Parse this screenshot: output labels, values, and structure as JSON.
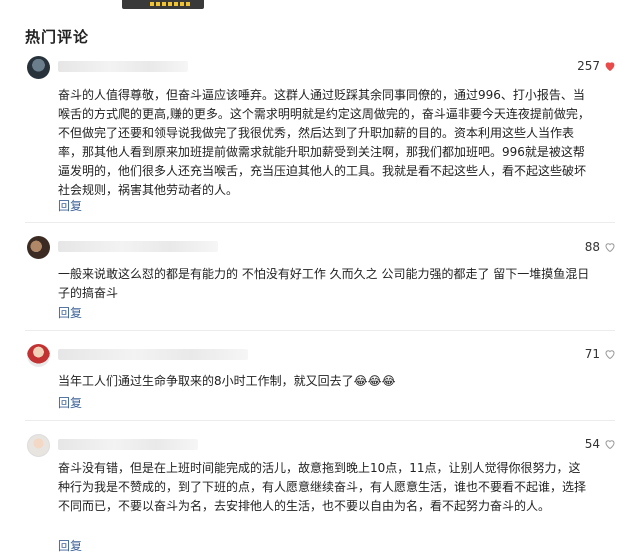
{
  "section_title": "热门评论",
  "comments": [
    {
      "likes": "257",
      "liked": true,
      "text": "奋斗的人值得尊敬，但奋斗逼应该唾弃。这群人通过贬踩其余同事同僚的，通过996、打小报告、当喉舌的方式爬的更高,赚的更多。这个需求明明就是约定这周做完的，奋斗逼非要今天连夜提前做完，不但做完了还要和领导说我做完了我很优秀，然后达到了升职加薪的目的。资本利用这些人当作表率，那其他人看到原来加班提前做需求就能升职加薪受到关注啊，那我们都加班吧。996就是被这帮逼发明的，他们很多人还充当喉舌，充当压迫其他人的工具。我就是看不起这些人，看不起这些破坏社会规则，祸害其他劳动者的人。",
      "reply": "回复"
    },
    {
      "likes": "88",
      "liked": false,
      "text": "一般来说敢这么怼的都是有能力的 不怕没有好工作 久而久之 公司能力强的都走了 留下一堆摸鱼混日子的搞奋斗",
      "reply": "回复"
    },
    {
      "likes": "71",
      "liked": false,
      "text": "当年工人们通过生命争取来的8小时工作制，就又回去了😂😂😂",
      "reply": "回复"
    },
    {
      "likes": "54",
      "liked": false,
      "text": "奋斗没有错，但是在上班时间能完成的活儿，故意拖到晚上10点，11点，让别人觉得你很努力，这种行为我是不赞成的，到了下班的点，有人愿意继续奋斗，有人愿意生活，谁也不要看不起谁，选择不同而已，不要以奋斗为名，去安排他人的生活，也不要以自由为名，看不起努力奋斗的人。",
      "reply": "回复"
    }
  ],
  "colors": {
    "heart_liked": "#e94a4a",
    "heart_outline": "#9a9a9a",
    "reply": "#406599"
  }
}
